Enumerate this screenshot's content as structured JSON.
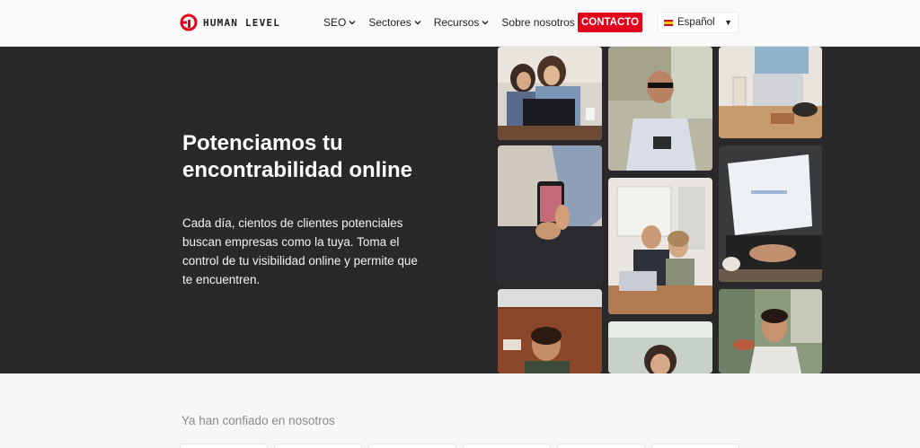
{
  "brand": {
    "name": "HUMAN LEVEL",
    "accent": "#e3001b"
  },
  "nav": {
    "items": [
      {
        "label": "SEO"
      },
      {
        "label": "Sectores"
      },
      {
        "label": "Recursos"
      },
      {
        "label": "Sobre nosotros"
      }
    ],
    "cta_label": "CONTACTO",
    "language": {
      "selected": "Español",
      "icon": "spain-flag-icon"
    }
  },
  "hero": {
    "title": "Potenciamos tu encontrabilidad online",
    "text": "Cada día, cientos de clientes potenciales buscan empresas como la tuya. Toma el control de tu visibilidad online y permite que te encuentren.",
    "background": "#2b282c"
  },
  "trust": {
    "label": "Ya han confiado en nosotros"
  }
}
